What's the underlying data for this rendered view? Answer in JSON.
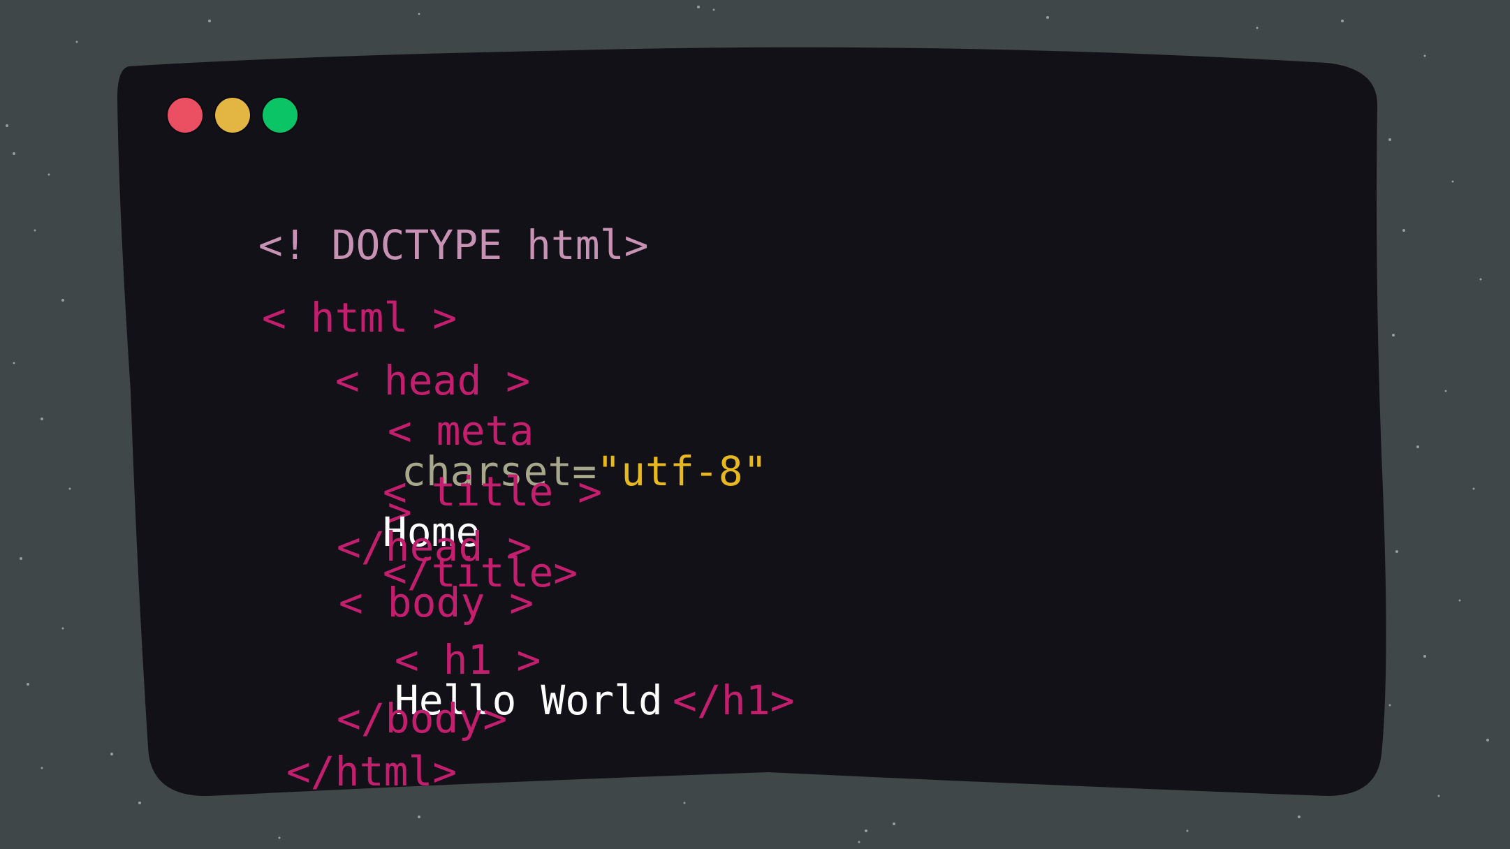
{
  "colors": {
    "background": "#3f4749",
    "window_bg": "#121118",
    "doctype": "#c892b4",
    "tag": "#c41f6f",
    "attribute": "#a7a88b",
    "string": "#e7b91f",
    "text": "#ffffff",
    "close_dot": "#eb5062",
    "minimize_dot": "#e3b644",
    "maximize_dot": "#0bc466"
  },
  "window_controls": [
    {
      "name": "close-button",
      "icon": "red-circle-icon",
      "color_key": "close_dot"
    },
    {
      "name": "minimize-button",
      "icon": "yellow-circle-icon",
      "color_key": "minimize_dot"
    },
    {
      "name": "maximize-button",
      "icon": "green-circle-icon",
      "color_key": "maximize_dot"
    }
  ],
  "code": {
    "doctype": "<! DOCTYPE html>",
    "html_open": "< html >",
    "head_open": "< head >",
    "meta_open": "< meta",
    "meta_attr": "charset=",
    "meta_value": "\"utf-8\"",
    "meta_close": ">",
    "title_open": "< title >",
    "title_text": "Home",
    "title_close": "</title>",
    "head_close": "</head >",
    "body_open": "< body >",
    "h1_open": "< h1 >",
    "h1_text": "Hello World",
    "h1_close": "</h1>",
    "body_close": "</body>",
    "html_close": "</html>"
  }
}
